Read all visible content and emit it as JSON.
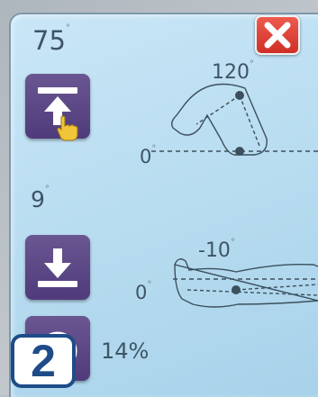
{
  "flexion": {
    "current_value": "75",
    "target_label": "120",
    "zero_label": "0",
    "degree_symbol": "°"
  },
  "extension": {
    "current_value": "9",
    "target_label": "-10",
    "zero_label": "0",
    "degree_symbol": "°"
  },
  "speed": {
    "value": "14%"
  },
  "badge": {
    "number": "2"
  },
  "icons": {
    "up": "arrow-up-to-bar-icon",
    "down": "arrow-down-to-bar-icon",
    "close": "close-icon",
    "speed": "concentric-rings-icon",
    "cursor": "hand-pointer-icon"
  },
  "colors": {
    "screen_bg": "#c1e1f4",
    "button": "#5a4685",
    "close": "#e0433a",
    "badge_border": "#1e4c88",
    "text": "#3e5565"
  }
}
